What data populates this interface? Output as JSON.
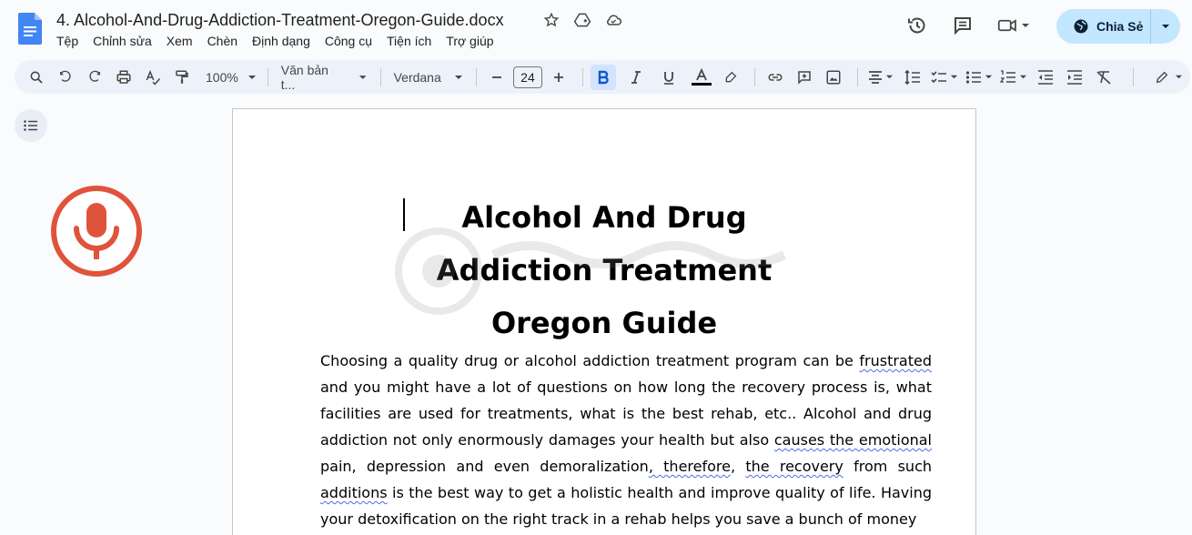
{
  "header": {
    "title": "4. Alcohol-And-Drug-Addiction-Treatment-Oregon-Guide.docx",
    "title_icons": [
      "star-icon",
      "move-to-drive-icon",
      "cloud-status-icon"
    ],
    "menu": [
      "Tệp",
      "Chỉnh sửa",
      "Xem",
      "Chèn",
      "Định dạng",
      "Công cụ",
      "Tiện ích",
      "Trợ giúp"
    ],
    "share_label": "Chia Sẻ"
  },
  "toolbar": {
    "zoom": "100%",
    "style": "Văn bản t...",
    "font": "Verdana",
    "font_size": "24"
  },
  "document": {
    "heading": "Alcohol And Drug Addiction Treatment Oregon Guide",
    "p1": "Choosing a quality drug or alcohol addiction treatment program can be ",
    "s1": "frustrated",
    "p2": " and you might have a lot of questions on how long the recovery process is, what facilities are used for treatments, what is the best rehab, etc.. Alcohol and drug addiction not only enormously damages your health but also ",
    "s2": "causes the emotional",
    "p3": " pain, depression and even demoralization",
    "s3": ", therefore",
    "p4": ", ",
    "s4": "the recovery",
    "p5": " from such ",
    "s5": "additions",
    "p6": " is the best way to get a holistic health and improve quality of life. Having your detoxification on the right track in a rehab helps you save a bunch of money"
  },
  "colors": {
    "accent": "#c2e7ff",
    "mic": "#e0533b",
    "docs_blue": "#4285f4",
    "toolbar_bg": "#edf2fa"
  }
}
